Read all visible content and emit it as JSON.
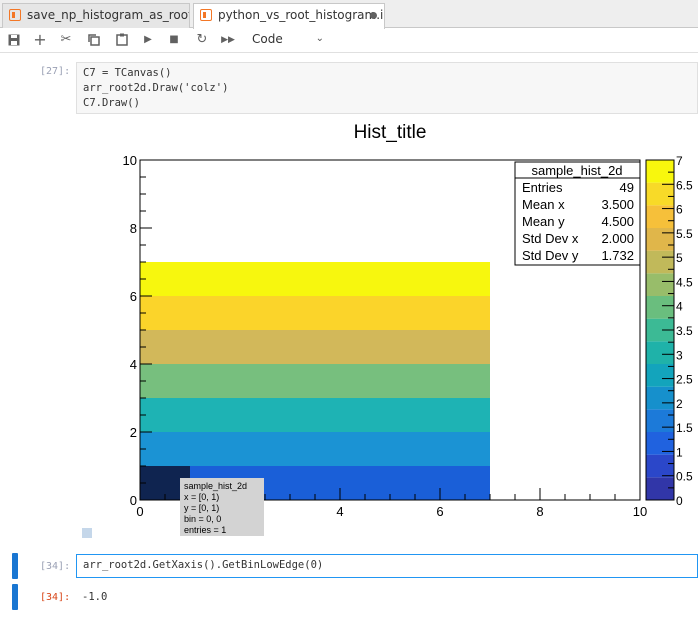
{
  "tabs": [
    {
      "label": "save_np_histogram_as_root.i"
    },
    {
      "label": "python_vs_root_histogram.ip"
    }
  ],
  "toolbar": {
    "icons": [
      "save-icon",
      "add-cell-icon",
      "cut-icon",
      "copy-icon",
      "paste-icon",
      "run-icon",
      "stop-icon",
      "restart-icon",
      "run-all-icon"
    ],
    "cell_type": "Code"
  },
  "cell27": {
    "prompt": "[27]:",
    "lines": [
      "C7 = TCanvas()",
      "arr_root2d.Draw('colz')",
      "C7.Draw()"
    ]
  },
  "cell34": {
    "prompt_in": "[34]:",
    "code": "arr_root2d.GetXaxis().GetBinLowEdge(0)",
    "prompt_out": "[34]:",
    "output": "-1.0"
  },
  "plot": {
    "title": "Hist_title",
    "stats": {
      "name": "sample_hist_2d",
      "rows": [
        {
          "label": "Entries",
          "value": "49"
        },
        {
          "label": "Mean x",
          "value": "3.500"
        },
        {
          "label": "Mean y",
          "value": "4.500"
        },
        {
          "label": "Std Dev x",
          "value": "2.000"
        },
        {
          "label": "Std Dev y",
          "value": "1.732"
        }
      ]
    },
    "tooltip": [
      "sample_hist_2d",
      "x = [0, 1)",
      "y = [0, 1)",
      "bin = 0, 0",
      "entries = 1"
    ]
  },
  "chart_data": {
    "type": "heatmap",
    "title": "Hist_title",
    "x_range": [
      0,
      10
    ],
    "y_range": [
      0,
      10
    ],
    "z_range": [
      0,
      7
    ],
    "x_ticks": [
      "0",
      "2",
      "4",
      "6",
      "8",
      "10"
    ],
    "y_ticks": [
      "0",
      "2",
      "4",
      "6",
      "8",
      "10"
    ],
    "z_ticks": [
      "0",
      "0.5",
      "1",
      "1.5",
      "2",
      "2.5",
      "3",
      "3.5",
      "4",
      "4.5",
      "5",
      "5.5",
      "6",
      "6.5",
      "7"
    ],
    "bins": {
      "x_from": 0,
      "x_to": 7,
      "y_rows": [
        0,
        1,
        2,
        3,
        4,
        5,
        6
      ]
    },
    "row_values": [
      1,
      2,
      3,
      4,
      5,
      6,
      7
    ],
    "first_cell_value": 0,
    "colors": {
      "0": "#0f2450",
      "1": "#1a5fd8",
      "2": "#1b93d4",
      "3": "#1eb3b4",
      "4": "#77bf7e",
      "5": "#d2b85a",
      "6": "#fbd42a",
      "7": "#f7f70e"
    },
    "palette": [
      "#3136a8",
      "#2b47c9",
      "#2062df",
      "#1c7ad9",
      "#1690cc",
      "#13a4bc",
      "#1fb2a9",
      "#3cba95",
      "#6abe7e",
      "#98bd6a",
      "#c1b95a",
      "#e0b64a",
      "#f6c03a",
      "#f8da28",
      "#f8f70d"
    ]
  }
}
